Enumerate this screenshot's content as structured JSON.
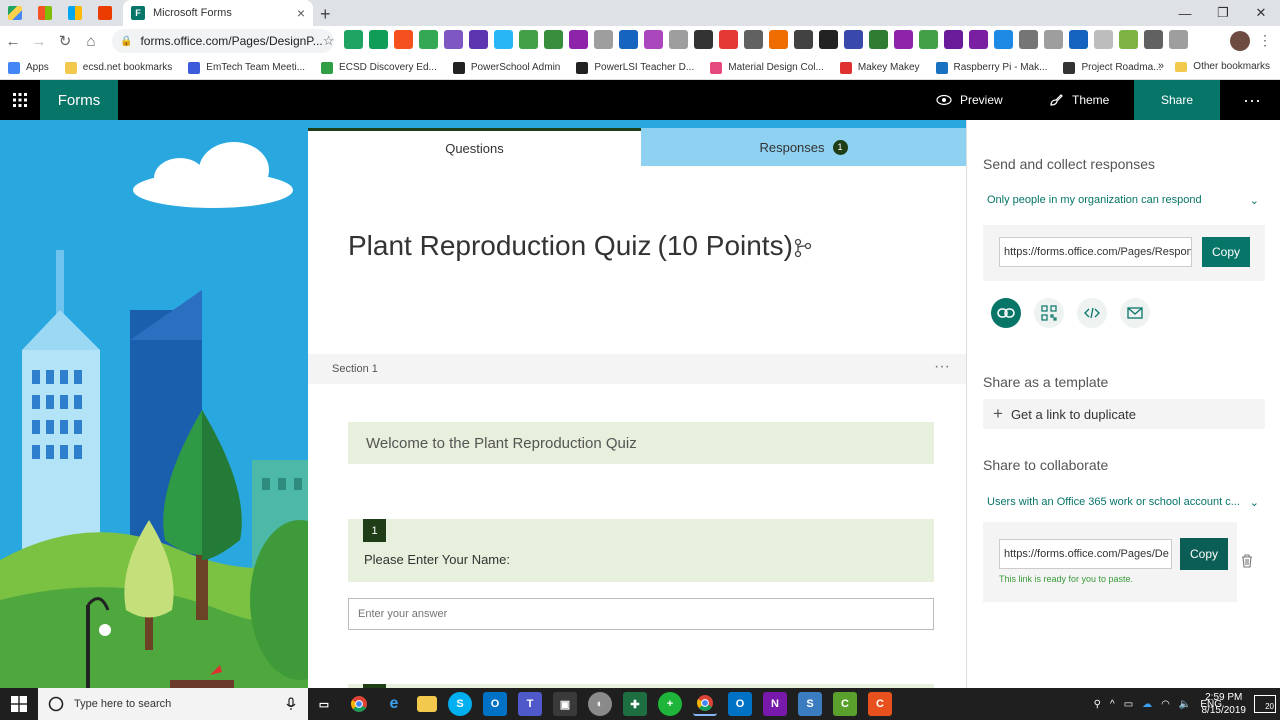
{
  "browser": {
    "tab_title": "Microsoft Forms",
    "url": "forms.office.com/Pages/DesignP...",
    "bookmarks": [
      {
        "label": "Apps",
        "color": "#4285f4"
      },
      {
        "label": "ecsd.net bookmarks",
        "color": "#f2c94c"
      },
      {
        "label": "EmTech Team Meeti...",
        "color": "#3b5bdb"
      },
      {
        "label": "ECSD Discovery Ed...",
        "color": "#2f9e44"
      },
      {
        "label": "PowerSchool Admin",
        "color": "#222222"
      },
      {
        "label": "PowerLSI Teacher D...",
        "color": "#222222"
      },
      {
        "label": "Material Design Col...",
        "color": "#e64980"
      },
      {
        "label": "Makey Makey",
        "color": "#e03131"
      },
      {
        "label": "Raspberry Pi - Mak...",
        "color": "#1971c2"
      },
      {
        "label": "Project Roadma...",
        "color": "#333333"
      }
    ],
    "bookmarks_overflow": "»",
    "other_bookmarks": "Other bookmarks"
  },
  "app": {
    "brand": "Forms",
    "preview_label": "Preview",
    "theme_label": "Theme",
    "share_label": "Share",
    "more_label": "···"
  },
  "form": {
    "tab_questions": "Questions",
    "tab_responses": "Responses",
    "responses_count": "1",
    "title": "Plant Reproduction Quiz",
    "points": "(10 Points)",
    "section_label": "Section 1",
    "section_more": "···",
    "welcome_text": "Welcome to the Plant Reproduction Quiz",
    "question_number": "1",
    "question_text": "Please Enter Your Name:",
    "answer_placeholder": "Enter your answer"
  },
  "share_pane": {
    "send_heading": "Send and collect responses",
    "audience": "Only people in my organization can respond",
    "response_url": "https://forms.office.com/Pages/Respon",
    "copy_label": "Copy",
    "template_heading": "Share as a template",
    "duplicate_label": "Get a link to duplicate",
    "collab_heading": "Share to collaborate",
    "collab_audience": "Users with an Office 365 work or school account c...",
    "collab_url": "https://forms.office.com/Pages/De",
    "collab_copy_label": "Copy",
    "ready_message": "This link is ready for you to paste."
  },
  "taskbar": {
    "search_placeholder": "Type here to search",
    "language": "ENG",
    "time": "2:59 PM",
    "date": "8/15/2019",
    "notification_count": "20"
  },
  "colors": {
    "forms_teal": "#077568",
    "dark_green": "#1f3d17",
    "sky_blue": "#29a8e0",
    "card_green": "#e6f0dc"
  }
}
